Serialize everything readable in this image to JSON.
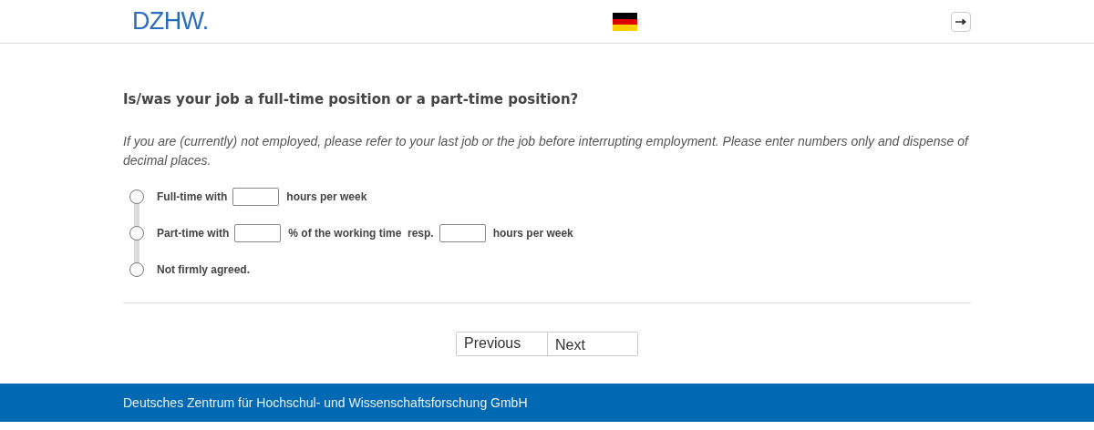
{
  "header": {
    "logo": "DZHW."
  },
  "question": {
    "title": "Is/was your job a full-time position or a part-time position?",
    "instruction": "If you are (currently) not employed, please refer to your last job or the job before interrupting employment. Please enter numbers only and dispense of decimal places.",
    "options": [
      {
        "selected": false,
        "parts": [
          {
            "kind": "text",
            "text": "Full-time with"
          },
          {
            "kind": "input"
          },
          {
            "kind": "text",
            "text": "hours per week"
          }
        ]
      },
      {
        "selected": false,
        "parts": [
          {
            "kind": "text",
            "text": "Part-time with"
          },
          {
            "kind": "input"
          },
          {
            "kind": "text",
            "text": "% of the working time  resp."
          },
          {
            "kind": "input"
          },
          {
            "kind": "text",
            "text": "hours per week"
          }
        ]
      },
      {
        "selected": false,
        "parts": [
          {
            "kind": "text",
            "text": "Not firmly agreed."
          }
        ]
      }
    ]
  },
  "buttons": [
    "Previous",
    "Next"
  ],
  "footer": "Deutsches Zentrum für Hochschul- und Wissenschaftsforschung GmbH"
}
